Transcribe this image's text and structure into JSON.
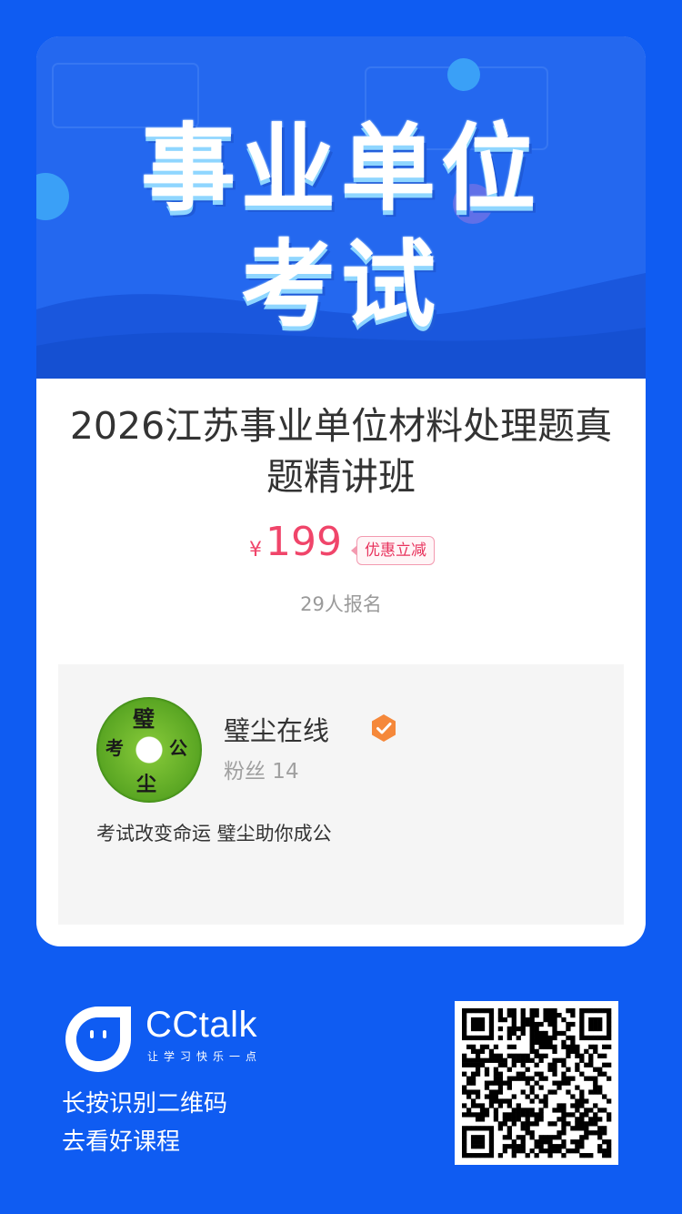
{
  "banner": {
    "line1": "事业单位",
    "line2": "考试"
  },
  "course": {
    "title": "2026江苏事业单位材料处理题真题精讲班",
    "currency": "¥",
    "price": "199",
    "discount_badge": "优惠立减",
    "enrollment": "29人报名"
  },
  "author": {
    "avatar_chars": [
      "璧",
      "考",
      "公",
      "尘"
    ],
    "name": "璧尘在线",
    "fans": "粉丝 14",
    "bio": "考试改变命运 璧尘助你成公"
  },
  "footer": {
    "brand": "CCtalk",
    "slogan": "让学习快乐一点",
    "hint_line1": "长按识别二维码",
    "hint_line2": "去看好课程"
  },
  "colors": {
    "background": "#0f5cf2",
    "price": "#f0456a",
    "verified_badge": "#f5883a"
  }
}
